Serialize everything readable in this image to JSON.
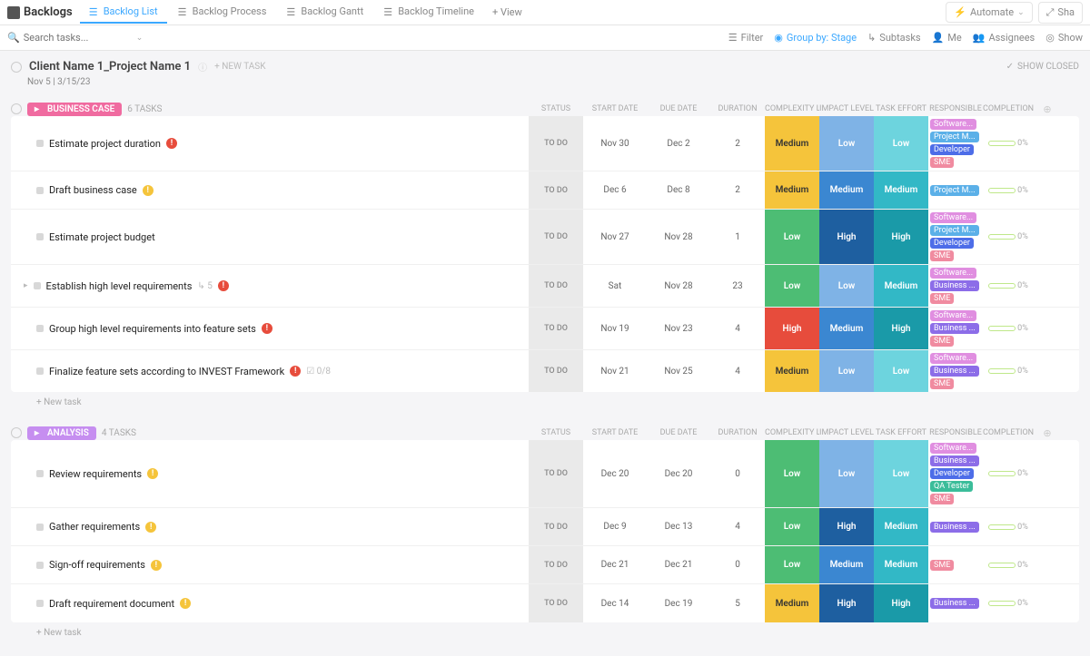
{
  "header": {
    "title": "Backlogs",
    "tabs": [
      {
        "label": "Backlog List",
        "active": true
      },
      {
        "label": "Backlog Process",
        "active": false
      },
      {
        "label": "Backlog Gantt",
        "active": false
      },
      {
        "label": "Backlog Timeline",
        "active": false
      }
    ],
    "add_view": "+ View",
    "automate": "Automate",
    "share": "Sha"
  },
  "toolbar": {
    "search_placeholder": "Search tasks...",
    "filter": "Filter",
    "group_by": "Group by: Stage",
    "subtasks": "Subtasks",
    "me": "Me",
    "assignees": "Assignees",
    "show": "Show"
  },
  "list": {
    "name": "Client Name 1_Project Name 1",
    "new_task": "+ NEW TASK",
    "dates": "Nov 5   |   3/15/23",
    "show_closed": "SHOW CLOSED"
  },
  "columns": [
    "",
    "STATUS",
    "START DATE",
    "DUE DATE",
    "DURATION",
    "COMPLEXITY LEVEL",
    "IMPACT LEVEL",
    "TASK EFFORT",
    "RESPONSIBLE",
    "COMPLETION ...",
    ""
  ],
  "groups": [
    {
      "name": "Business Case",
      "color": "#f06ba0",
      "count": "6 TASKS",
      "tasks": [
        {
          "name": "Estimate project duration",
          "prio": "red",
          "status": "TO DO",
          "start": "Nov 30",
          "due": "Dec 2",
          "dur": "2",
          "cx": "Medium",
          "im": "Low",
          "ef": "Low",
          "resp": [
            "software",
            "project",
            "developer",
            "sme"
          ],
          "pct": "0%"
        },
        {
          "name": "Draft business case",
          "prio": "yellow",
          "status": "TO DO",
          "start": "Dec 6",
          "due": "Dec 8",
          "dur": "2",
          "cx": "Medium",
          "im": "Medium",
          "ef": "Medium",
          "resp": [
            "project"
          ],
          "pct": "0%"
        },
        {
          "name": "Estimate project budget",
          "prio": "",
          "status": "TO DO",
          "start": "Nov 27",
          "due": "Nov 28",
          "dur": "1",
          "cx": "Low",
          "im": "High",
          "ef": "High",
          "resp": [
            "software",
            "project",
            "developer",
            "sme"
          ],
          "pct": "0%"
        },
        {
          "name": "Establish high level requirements",
          "prio": "red",
          "status": "TO DO",
          "start": "Sat",
          "due": "Nov 28",
          "dur": "23",
          "cx": "Low",
          "im": "Low",
          "ef": "Medium",
          "resp": [
            "software",
            "business",
            "sme"
          ],
          "pct": "0%",
          "subtasks": "5",
          "expandable": true
        },
        {
          "name": "Group high level requirements into feature sets",
          "prio": "red",
          "status": "TO DO",
          "start": "Nov 19",
          "due": "Nov 23",
          "dur": "4",
          "cx": "High",
          "im": "Medium",
          "ef": "High",
          "resp": [
            "software",
            "business",
            "sme"
          ],
          "pct": "0%"
        },
        {
          "name": "Finalize feature sets according to INVEST Framework",
          "prio": "red",
          "status": "TO DO",
          "start": "Nov 21",
          "due": "Nov 25",
          "dur": "4",
          "cx": "Medium",
          "im": "Low",
          "ef": "Low",
          "resp": [
            "software",
            "business",
            "sme"
          ],
          "pct": "0%",
          "checklist": "0/8"
        }
      ]
    },
    {
      "name": "Analysis",
      "color": "#c68ef0",
      "count": "4 TASKS",
      "tasks": [
        {
          "name": "Review requirements",
          "prio": "yellow",
          "status": "TO DO",
          "start": "Dec 20",
          "due": "Dec 20",
          "dur": "0",
          "cx": "Low",
          "im": "Low",
          "ef": "Low",
          "resp": [
            "software",
            "business",
            "developer",
            "qa",
            "sme"
          ],
          "pct": "0%"
        },
        {
          "name": "Gather requirements",
          "prio": "yellow",
          "status": "TO DO",
          "start": "Dec 9",
          "due": "Dec 13",
          "dur": "4",
          "cx": "Low",
          "im": "High",
          "ef": "Medium",
          "resp": [
            "business"
          ],
          "pct": "0%"
        },
        {
          "name": "Sign-off requirements",
          "prio": "yellow",
          "status": "TO DO",
          "start": "Dec 21",
          "due": "Dec 21",
          "dur": "0",
          "cx": "Low",
          "im": "Medium",
          "ef": "Medium",
          "resp": [
            "sme"
          ],
          "pct": "0%"
        },
        {
          "name": "Draft requirement document",
          "prio": "yellow",
          "status": "TO DO",
          "start": "Dec 14",
          "due": "Dec 19",
          "dur": "5",
          "cx": "Medium",
          "im": "High",
          "ef": "High",
          "resp": [
            "business"
          ],
          "pct": "0%"
        }
      ]
    }
  ],
  "new_task_row": "+ New task",
  "chips": {
    "software": "Software...",
    "project": "Project M...",
    "developer": "Developer",
    "sme": "SME",
    "business": "Business ...",
    "qa": "QA Tester"
  }
}
